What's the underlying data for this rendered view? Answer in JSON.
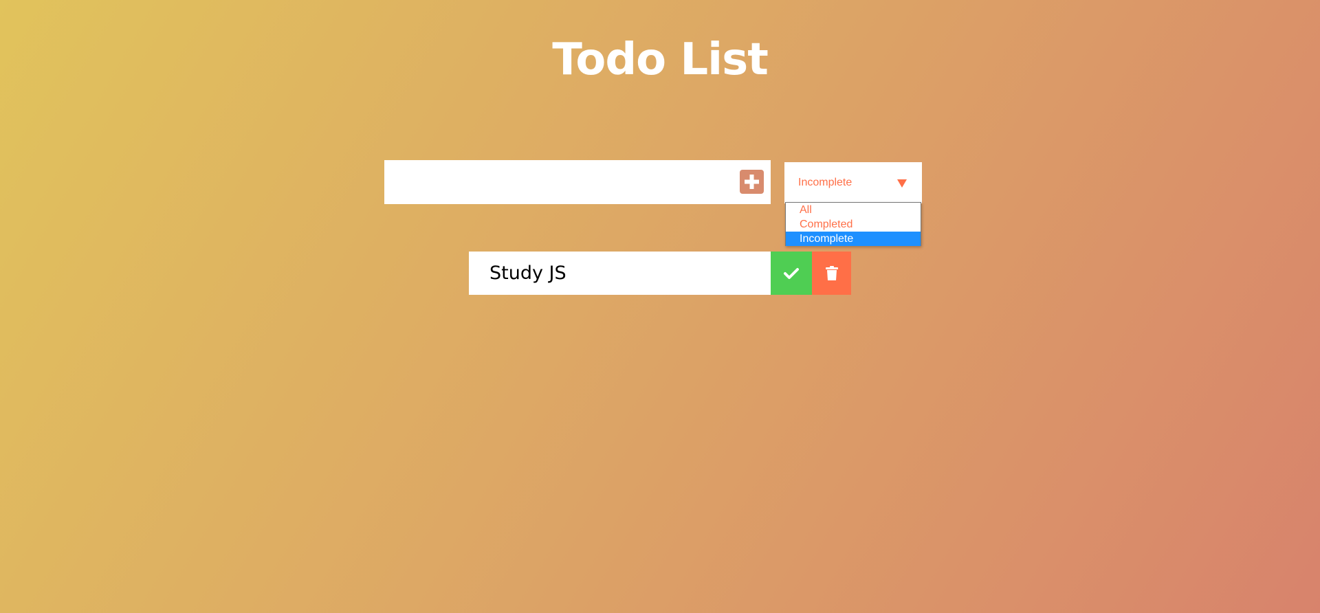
{
  "header": {
    "title": "Todo List"
  },
  "form": {
    "input_value": "",
    "add_icon": "plus-square-icon"
  },
  "filter": {
    "selected": "Incomplete",
    "options": [
      "All",
      "Completed",
      "Incomplete"
    ],
    "highlighted_index": 2,
    "arrow_icon": "caret-down-icon"
  },
  "todos": [
    {
      "text": "Study JS",
      "complete_icon": "check-icon",
      "delete_icon": "trash-icon"
    }
  ],
  "colors": {
    "accent": "#ff6f47",
    "add_button": "#d88b6d",
    "complete": "#4fce53",
    "selected_option": "#1e90ff",
    "gradient_start": "#e1c35c",
    "gradient_end": "#d8836c"
  }
}
